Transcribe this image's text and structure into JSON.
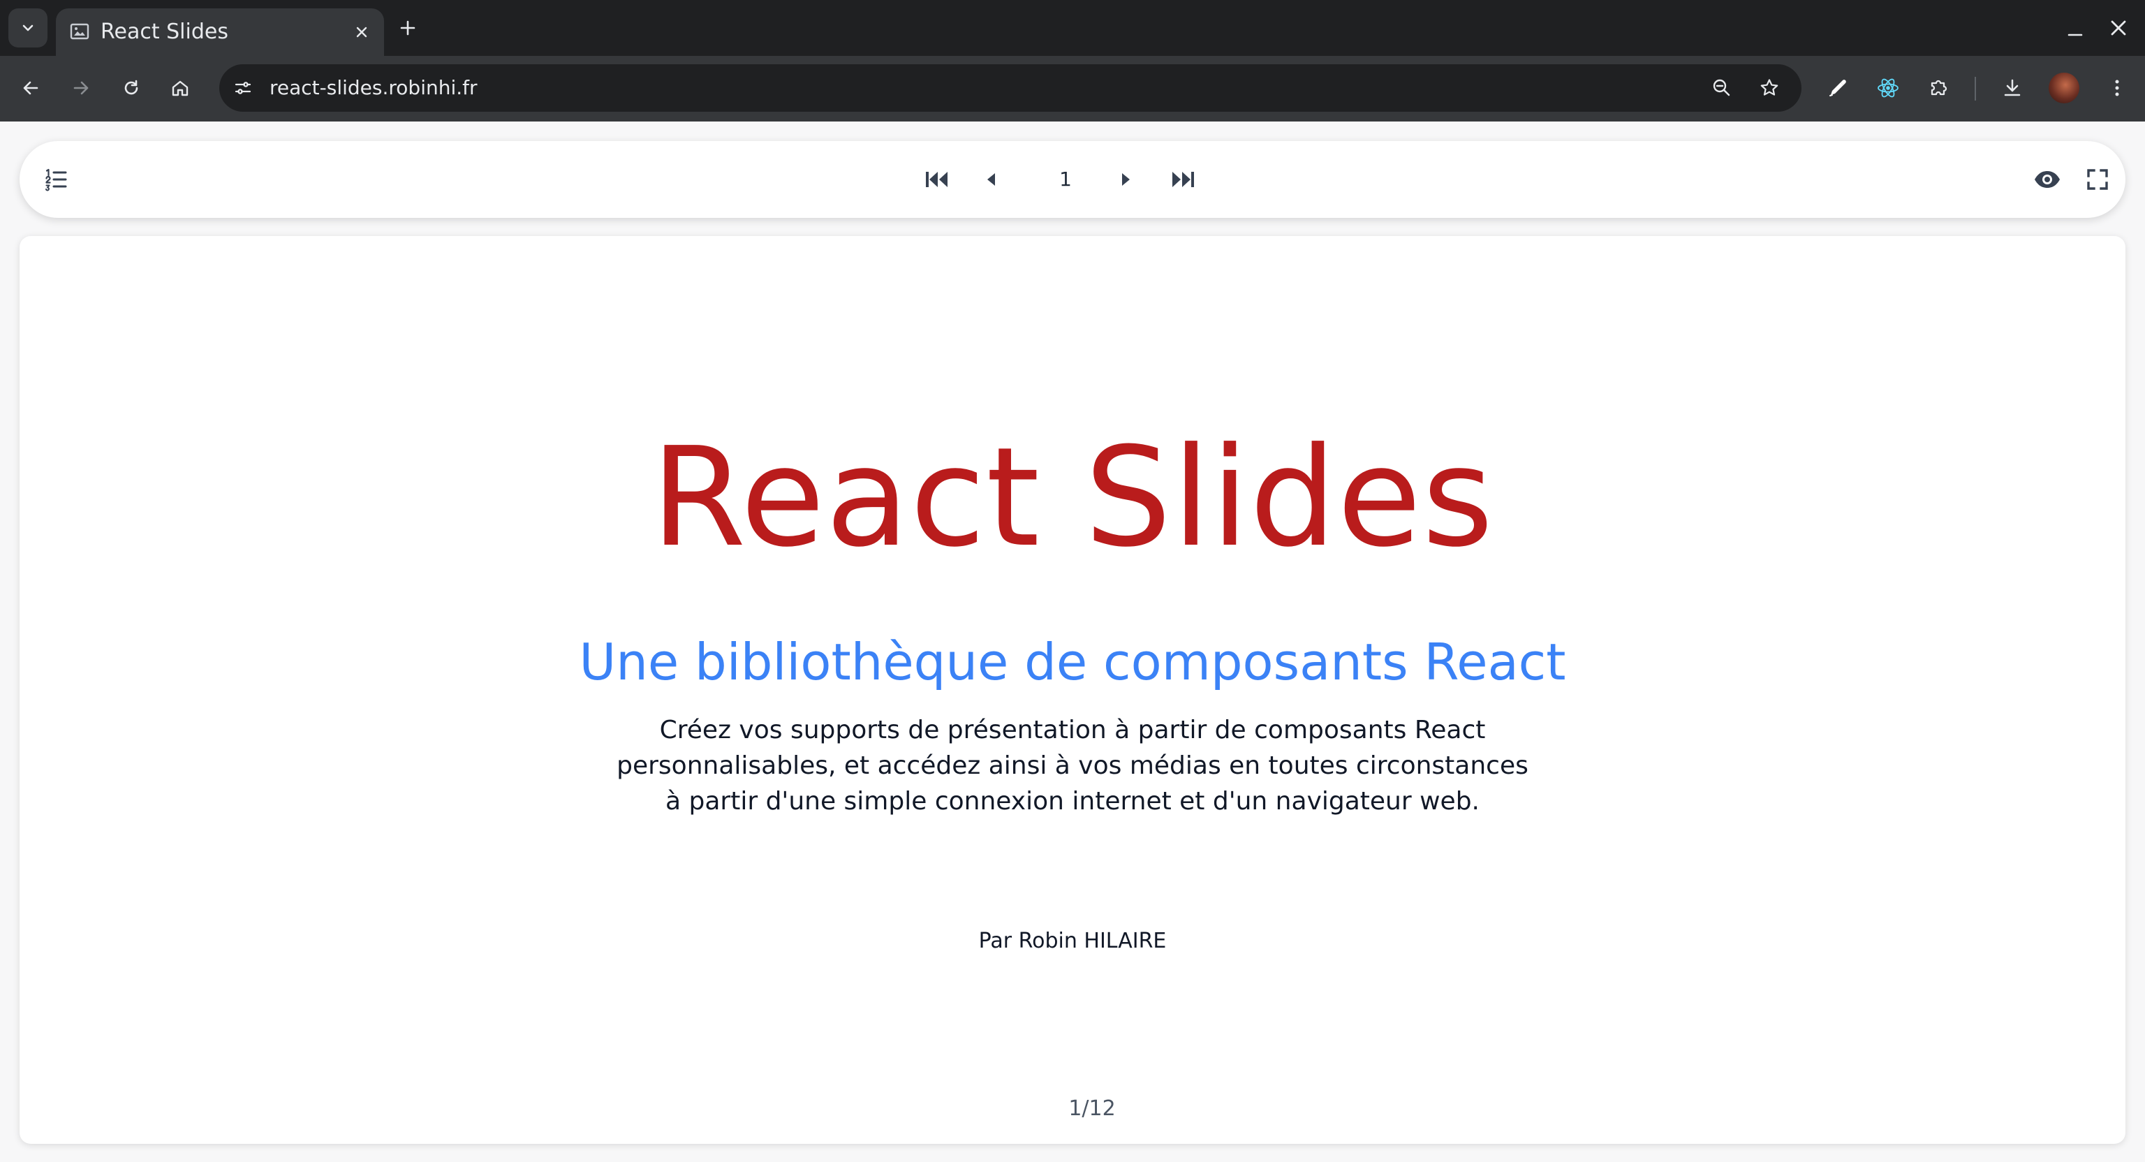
{
  "browser": {
    "tab": {
      "title": "React Slides",
      "favicon": "slides-favicon-icon"
    },
    "omnibox": {
      "url": "react-slides.robinhi.fr"
    },
    "icons": {
      "tab_search": "chevron-down-icon",
      "tab_close": "close-icon",
      "new_tab": "plus-icon",
      "minimize": "minimize-icon",
      "window_close": "close-icon",
      "back": "arrow-left-icon",
      "forward": "arrow-right-icon",
      "reload": "reload-icon",
      "home": "home-icon",
      "site_info": "tune-icon",
      "zoom": "zoom-out-icon",
      "bookmark": "star-icon",
      "eyedropper": "eyedropper-icon",
      "react_devtools": "react-icon",
      "extensions": "puzzle-icon",
      "downloads": "download-icon",
      "profile": "avatar",
      "menu": "kebab-menu-icon"
    }
  },
  "slides_nav": {
    "current_page": "1",
    "icons": {
      "toc": "numbered-list-icon",
      "first": "skip-first-icon",
      "previous": "caret-left-icon",
      "next": "caret-right-icon",
      "last": "skip-last-icon",
      "presenter": "eye-icon",
      "fullscreen": "fullscreen-icon"
    }
  },
  "slide": {
    "title": "React Slides",
    "subtitle": "Une bibliothèque de composants React",
    "description": [
      "Créez vos supports de présentation à partir de composants React",
      "personnalisables, et accédez ainsi à vos médias en toutes circonstances",
      "à partir d'une simple connexion internet et d'un navigateur web."
    ],
    "author": "Par Robin HILAIRE",
    "counter": "1/12"
  },
  "colors": {
    "chrome_dark": "#1f2022",
    "chrome_toolbar": "#36383b",
    "title_red": "#b91c1c",
    "subtitle_blue": "#3b82f6",
    "nav_icon": "#374151"
  }
}
